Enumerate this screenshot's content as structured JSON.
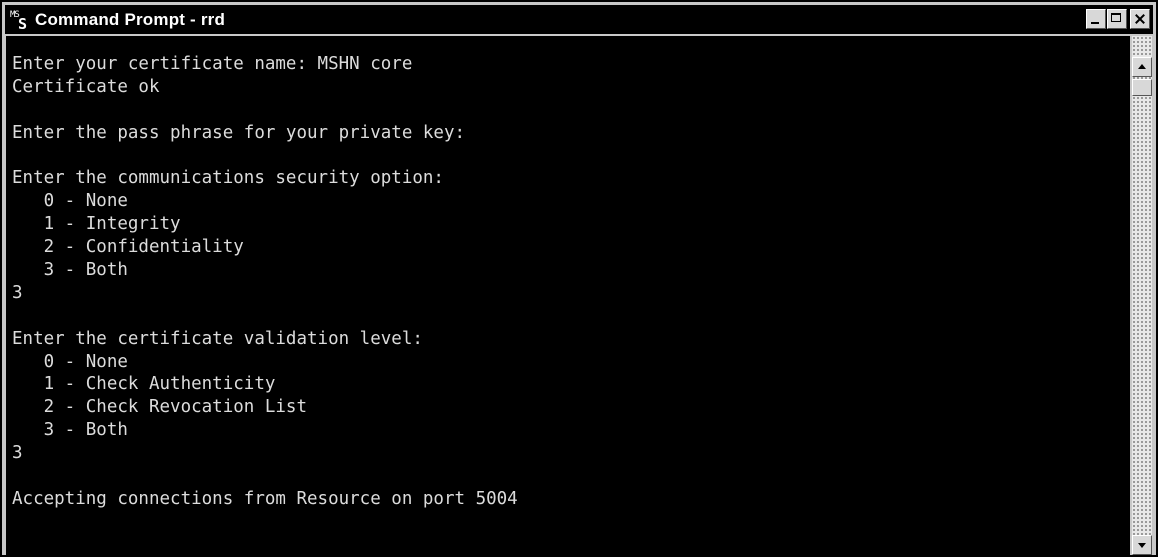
{
  "window": {
    "title": "Command Prompt - rrd",
    "icon": "command-prompt-icon",
    "icon_text_top": "MS",
    "icon_text_main": "S",
    "controls": [
      "minimize-icon",
      "maximize-icon",
      "close-icon"
    ]
  },
  "console": {
    "lines": [
      "Enter your certificate name: MSHN core",
      "Certificate ok",
      "",
      "Enter the pass phrase for your private key:",
      "",
      "Enter the communications security option:",
      "   0 - None",
      "   1 - Integrity",
      "   2 - Confidentiality",
      "   3 - Both",
      "3",
      "",
      "Enter the certificate validation level:",
      "   0 - None",
      "   1 - Check Authenticity",
      "   2 - Check Revocation List",
      "   3 - Both",
      "3",
      "",
      "Accepting connections from Resource on port 5004"
    ]
  },
  "scrollbar": {
    "up_icon": "scroll-up-arrow-icon",
    "down_icon": "scroll-down-arrow-icon"
  },
  "colors": {
    "console_background": "#000000",
    "console_text": "#dcdcdc",
    "titlebar_background": "#000000",
    "titlebar_text": "#ffffff"
  }
}
